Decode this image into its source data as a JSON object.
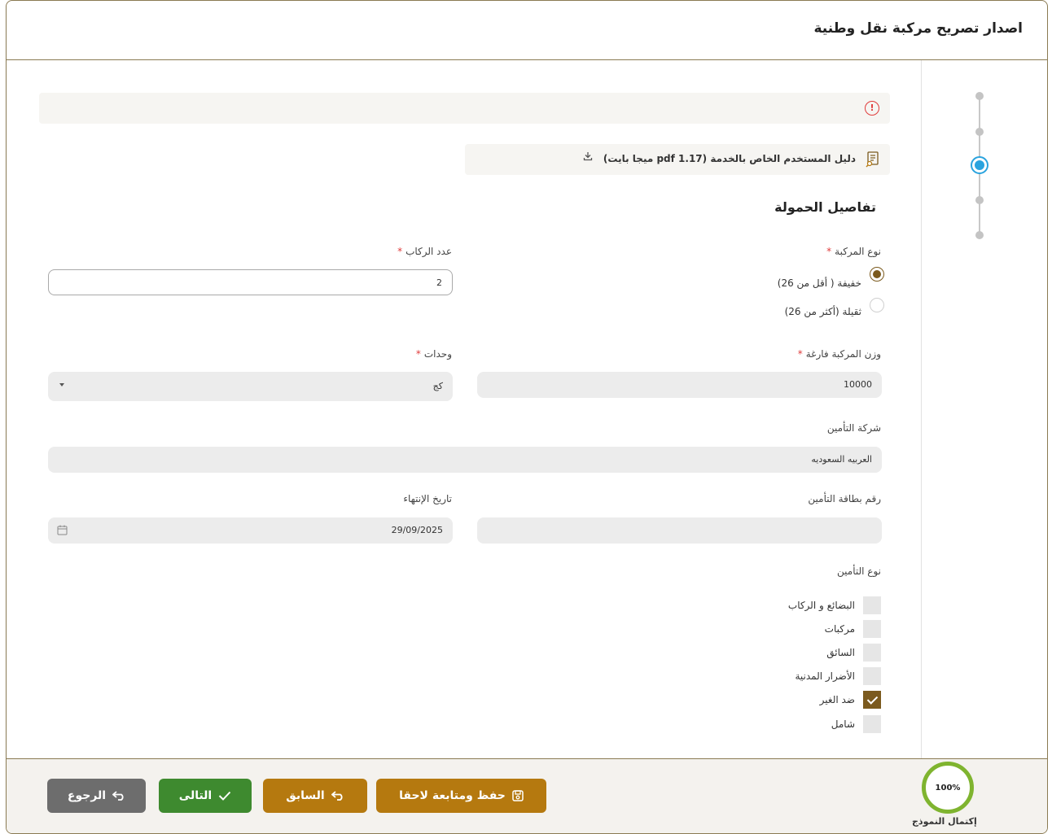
{
  "header": {
    "title": "اصدار تصريح مركبة نقل وطنية"
  },
  "alert": {
    "icon": "warning-icon"
  },
  "guide": {
    "text": "دليل المستخدم الخاص بالخدمة (1.17 pdf ميجا بايت)",
    "icon": "document-search-icon",
    "download_icon": "download-icon"
  },
  "section": {
    "title": "تفاصيل الحمولة"
  },
  "form": {
    "vehicle_type": {
      "label": "نوع المركبة",
      "options": [
        "خفيفة ( أقل من 26)",
        "ثقيلة (أكثر من 26)"
      ],
      "selected_index": 0
    },
    "passengers": {
      "label": "عدد الركاب",
      "value": "2"
    },
    "empty_weight": {
      "label": "وزن المركبة فارغة",
      "value": "10000"
    },
    "units": {
      "label": "وحدات",
      "value": "كج"
    },
    "insurance_company": {
      "label": "شركة التأمين",
      "value": "العربيه السعوديه"
    },
    "insurance_card": {
      "label": "رقم بطاقة التأمين",
      "value": ""
    },
    "expiry_date": {
      "label": "تاريخ الإنتهاء",
      "value": "29/09/2025"
    },
    "insurance_type": {
      "label": "نوع التأمين",
      "options": [
        {
          "label": "البضائع و الركاب",
          "checked": false
        },
        {
          "label": "مركبات",
          "checked": false
        },
        {
          "label": "السائق",
          "checked": false
        },
        {
          "label": "الأضرار المدنية",
          "checked": false
        },
        {
          "label": "ضد الغير",
          "checked": true
        },
        {
          "label": "شامل",
          "checked": false
        }
      ]
    },
    "required_mark": "*"
  },
  "footer": {
    "progress": {
      "value": "100%",
      "label": "إكتمال النموذج",
      "fraction": 1.0
    },
    "save_label": "حفظ ومتابعة لاحقا",
    "prev_label": "السابق",
    "next_label": "التالى",
    "back_label": "الرجوع"
  },
  "colors": {
    "brand": "#b5790f",
    "success": "#3e8a2f",
    "accent": "#2aa3de",
    "required": "#e03c3c"
  },
  "stepper": {
    "steps": 5,
    "active_index": 2
  }
}
